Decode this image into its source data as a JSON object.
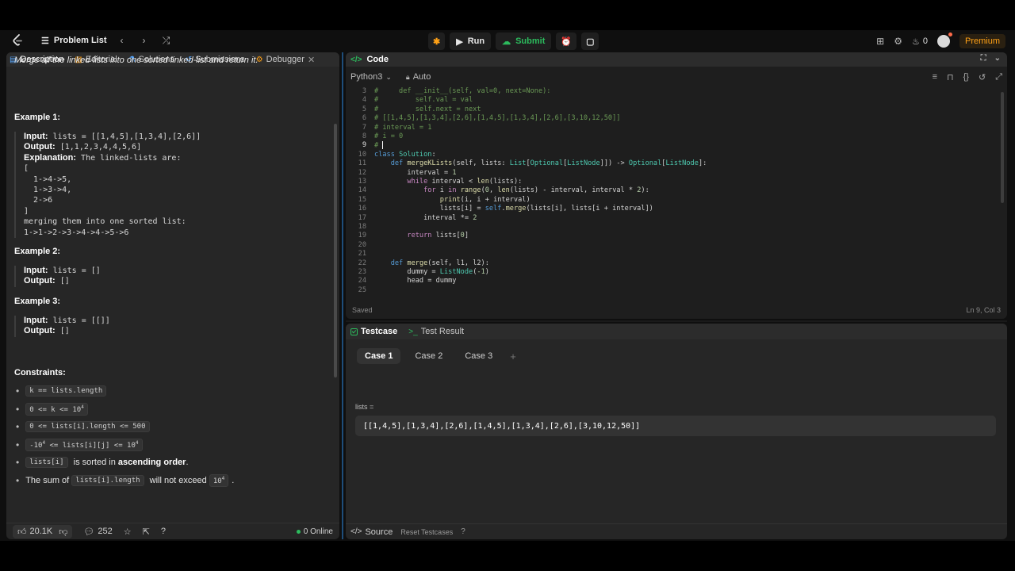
{
  "topbar": {
    "problem_list": "Problem List",
    "run": "Run",
    "submit": "Submit",
    "streak_count": "0",
    "premium": "Premium"
  },
  "left_tabs": [
    {
      "label": "Description",
      "icon": "document-icon"
    },
    {
      "label": "Editorial",
      "icon": "book-icon"
    },
    {
      "label": "Solutions",
      "icon": "flask-icon"
    },
    {
      "label": "Submissions",
      "icon": "history-icon"
    },
    {
      "label": "Debugger",
      "icon": "debugger-icon"
    }
  ],
  "description": {
    "intro": "Merge all the linked-lists into one sorted linked-list and return it.",
    "examples": [
      {
        "title": "Example 1:",
        "input_label": "Input:",
        "input": "lists = [[1,4,5],[1,3,4],[2,6]]",
        "output_label": "Output:",
        "output": "[1,1,2,3,4,4,5,6]",
        "explanation_label": "Explanation:",
        "explanation": "The linked-lists are:",
        "extra": [
          "[",
          "  1->4->5,",
          "  1->3->4,",
          "  2->6",
          "]",
          "merging them into one sorted list:",
          "1->1->2->3->4->4->5->6"
        ]
      },
      {
        "title": "Example 2:",
        "input_label": "Input:",
        "input": "lists = []",
        "output_label": "Output:",
        "output": "[]"
      },
      {
        "title": "Example 3:",
        "input_label": "Input:",
        "input": "lists = [[]]",
        "output_label": "Output:",
        "output": "[]"
      }
    ],
    "constraints_title": "Constraints:",
    "constraints": {
      "c1": "k == lists.length",
      "c2_code": "0 <= k <= 10",
      "c2_sup": "4",
      "c3": "0 <= lists[i].length <= 500",
      "c4_a": "-10",
      "c4_a_sup": "4",
      "c4_b": " <= lists[i][j] <= 10",
      "c4_b_sup": "4",
      "c5_code": "lists[i]",
      "c5_text": " is sorted in ",
      "c5_bold": "ascending order",
      "c5_end": ".",
      "c6_text": "The sum of ",
      "c6_code": "lists[i].length",
      "c6_mid": " will not exceed ",
      "c6_code2": "10",
      "c6_sup": "4",
      "c6_end": "."
    }
  },
  "left_footer": {
    "likes": "20.1K",
    "comments": "252",
    "online": "0 Online"
  },
  "code_panel": {
    "title": "Code",
    "language": "Python3",
    "mode": "Auto",
    "status": "Saved",
    "cursor": "Ln 9, Col 3"
  },
  "code_lines": [
    {
      "n": "3",
      "text": "#     def __init__(self, val=0, next=None):"
    },
    {
      "n": "4",
      "text": "#         self.val = val"
    },
    {
      "n": "5",
      "text": "#         self.next = next"
    },
    {
      "n": "6",
      "text": "# [[1,4,5],[1,3,4],[2,6],[1,4,5],[1,3,4],[2,6],[3,10,12,50]]"
    },
    {
      "n": "7",
      "text": "# interval = 1"
    },
    {
      "n": "8",
      "text": "# i = 0"
    },
    {
      "n": "9",
      "text": "# "
    },
    {
      "n": "10",
      "text": "class Solution:"
    },
    {
      "n": "11",
      "text": "    def mergeKLists(self, lists: List[Optional[ListNode]]) -> Optional[ListNode]:"
    },
    {
      "n": "12",
      "text": "        interval = 1"
    },
    {
      "n": "13",
      "text": "        while interval < len(lists):"
    },
    {
      "n": "14",
      "text": "            for i in range(0, len(lists) - interval, interval * 2):"
    },
    {
      "n": "15",
      "text": "                print(i, i + interval)"
    },
    {
      "n": "16",
      "text": "                lists[i] = self.merge(lists[i], lists[i + interval])"
    },
    {
      "n": "17",
      "text": "            interval *= 2"
    },
    {
      "n": "18",
      "text": ""
    },
    {
      "n": "19",
      "text": "        return lists[0]"
    },
    {
      "n": "20",
      "text": ""
    },
    {
      "n": "21",
      "text": ""
    },
    {
      "n": "22",
      "text": "    def merge(self, l1, l2):"
    },
    {
      "n": "23",
      "text": "        dummy = ListNode(-1)"
    },
    {
      "n": "24",
      "text": "        head = dummy"
    },
    {
      "n": "25",
      "text": ""
    }
  ],
  "tests": {
    "tab_testcase": "Testcase",
    "tab_result": "Test Result",
    "cases": [
      "Case 1",
      "Case 2",
      "Case 3"
    ],
    "var_label": "lists =",
    "var_value": "[[1,4,5],[1,3,4],[2,6],[1,4,5],[1,3,4],[2,6],[3,10,12,50]]",
    "footer_source": "Source",
    "footer_reset": "Reset Testcases"
  },
  "colors": {
    "accent_green": "#2cbb5d",
    "premium_orange": "#ffa116",
    "panel_bg": "#262626",
    "editor_bg": "#1e1e1e"
  }
}
